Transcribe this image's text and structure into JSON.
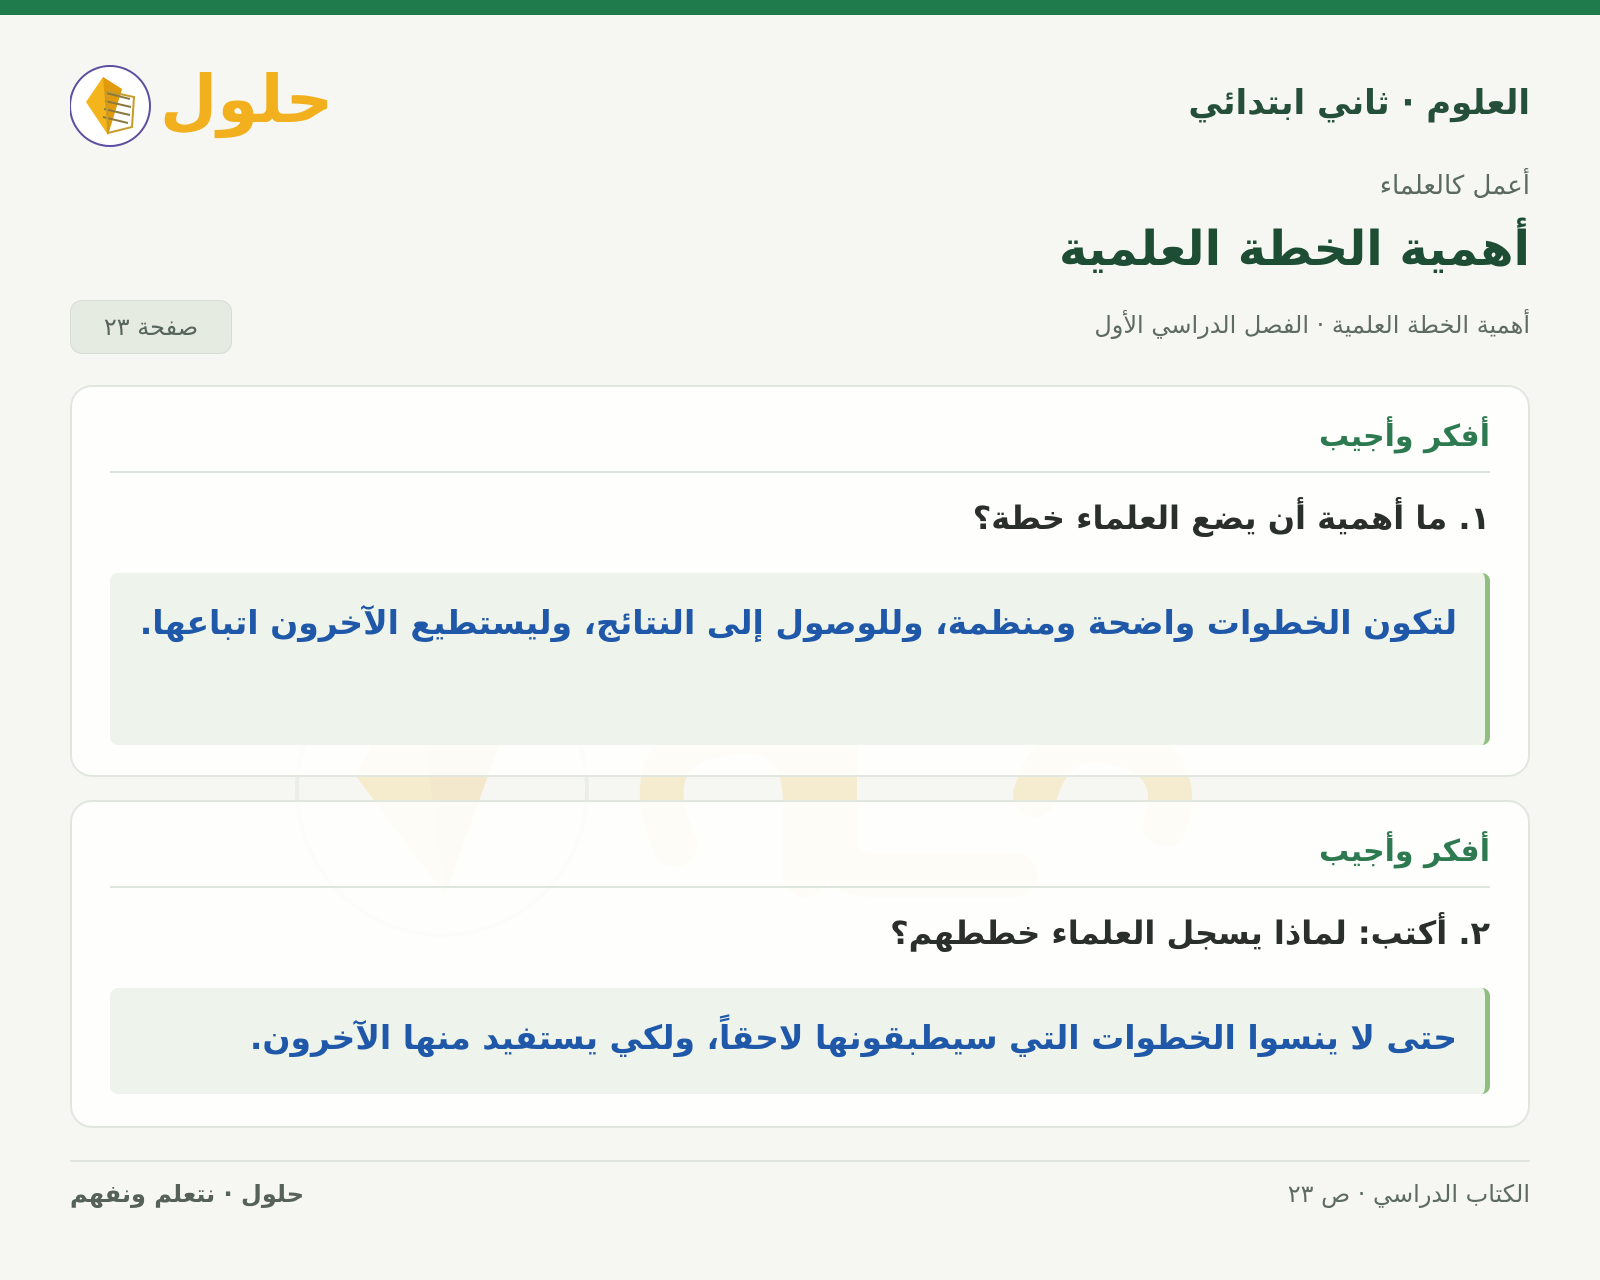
{
  "header": {
    "subject_title": "العلوم · ثاني ابتدائي",
    "logo_text": "حلول"
  },
  "lesson": {
    "kicker": "أعمل كالعلماء",
    "title": "أهمية الخطة العلمية",
    "breadcrumb": "أهمية الخطة العلمية · الفصل الدراسي الأول",
    "page_badge": "صفحة ٢٣"
  },
  "cards": [
    {
      "heading": "أفكر وأجيب",
      "question": "١. ما أهمية أن يضع العلماء خطة؟",
      "answer": "لتكون الخطوات واضحة ومنظمة، وللوصول إلى النتائج، وليستطيع الآخرون اتباعها."
    },
    {
      "heading": "أفكر وأجيب",
      "question": "٢. أكتب: لماذا يسجل العلماء خططهم؟",
      "answer": "حتى لا ينسوا الخطوات التي سيطبقونها لاحقاً، ولكي يستفيد منها الآخرون."
    }
  ],
  "footer": {
    "right_text": "الكتاب الدراسي · ص ٢٣",
    "left_text": "حلول · نتعلم ونفهم"
  },
  "colors": {
    "brand_green": "#1f7a4c",
    "heading_green": "#2d7a50",
    "answer_blue": "#1f58a8",
    "answer_bg": "#eef3ec",
    "logo_gold": "#f2b01e"
  },
  "icons": {
    "logo": "book-icon"
  }
}
